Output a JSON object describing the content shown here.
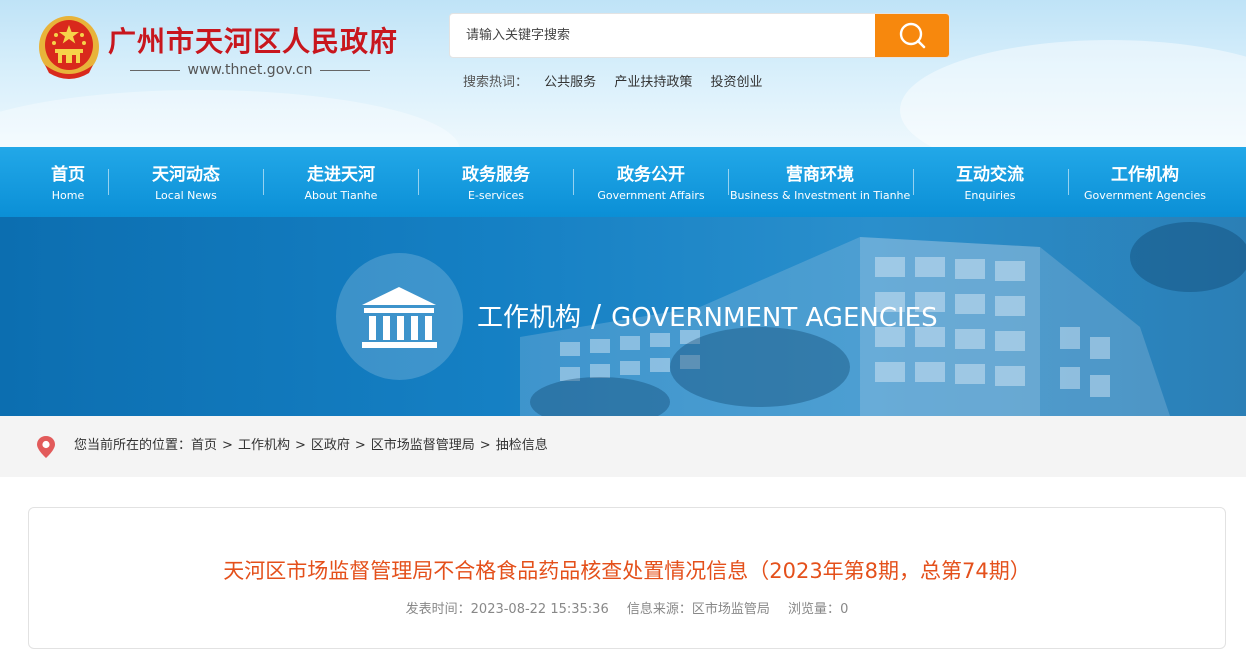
{
  "header": {
    "site_title": "广州市天河区人民政府",
    "site_domain": "www.thnet.gov.cn",
    "search": {
      "placeholder": "请输入关键字搜索"
    },
    "hot_label": "搜索热词：",
    "hot_words": [
      "公共服务",
      "产业扶持政策",
      "投资创业"
    ]
  },
  "nav": {
    "items": [
      {
        "zh": "首页",
        "en": "Home"
      },
      {
        "zh": "天河动态",
        "en": "Local News"
      },
      {
        "zh": "走进天河",
        "en": "About Tianhe"
      },
      {
        "zh": "政务服务",
        "en": "E-services"
      },
      {
        "zh": "政务公开",
        "en": "Government Affairs"
      },
      {
        "zh": "营商环境",
        "en": "Business & Investment in Tianhe"
      },
      {
        "zh": "互动交流",
        "en": "Enquiries"
      },
      {
        "zh": "工作机构",
        "en": "Government Agencies"
      }
    ]
  },
  "banner": {
    "title_zh": "工作机构",
    "separator": "/",
    "title_en": "GOVERNMENT AGENCIES"
  },
  "breadcrumb": {
    "prefix": "您当前所在的位置：",
    "items": [
      "首页",
      "工作机构",
      "区政府",
      "区市场监督管理局",
      "抽检信息"
    ],
    "separator": ">"
  },
  "article": {
    "title": "天河区市场监督管理局不合格食品药品核查处置情况信息（2023年第8期，总第74期）",
    "publish_label": "发表时间：",
    "publish_time": "2023-08-22 15:35:36",
    "source_label": "信息来源：",
    "source": "区市场监管局",
    "views_label": "浏览量：",
    "views": "0"
  },
  "colors": {
    "title_red": "#c8161d",
    "nav_blue": "#1a9de0",
    "search_orange": "#f7880d",
    "article_title": "#e4501b"
  },
  "icons": {
    "emblem": "national-emblem-icon",
    "search": "magnifier-icon",
    "banner": "government-building-icon",
    "location": "location-pin-icon"
  }
}
